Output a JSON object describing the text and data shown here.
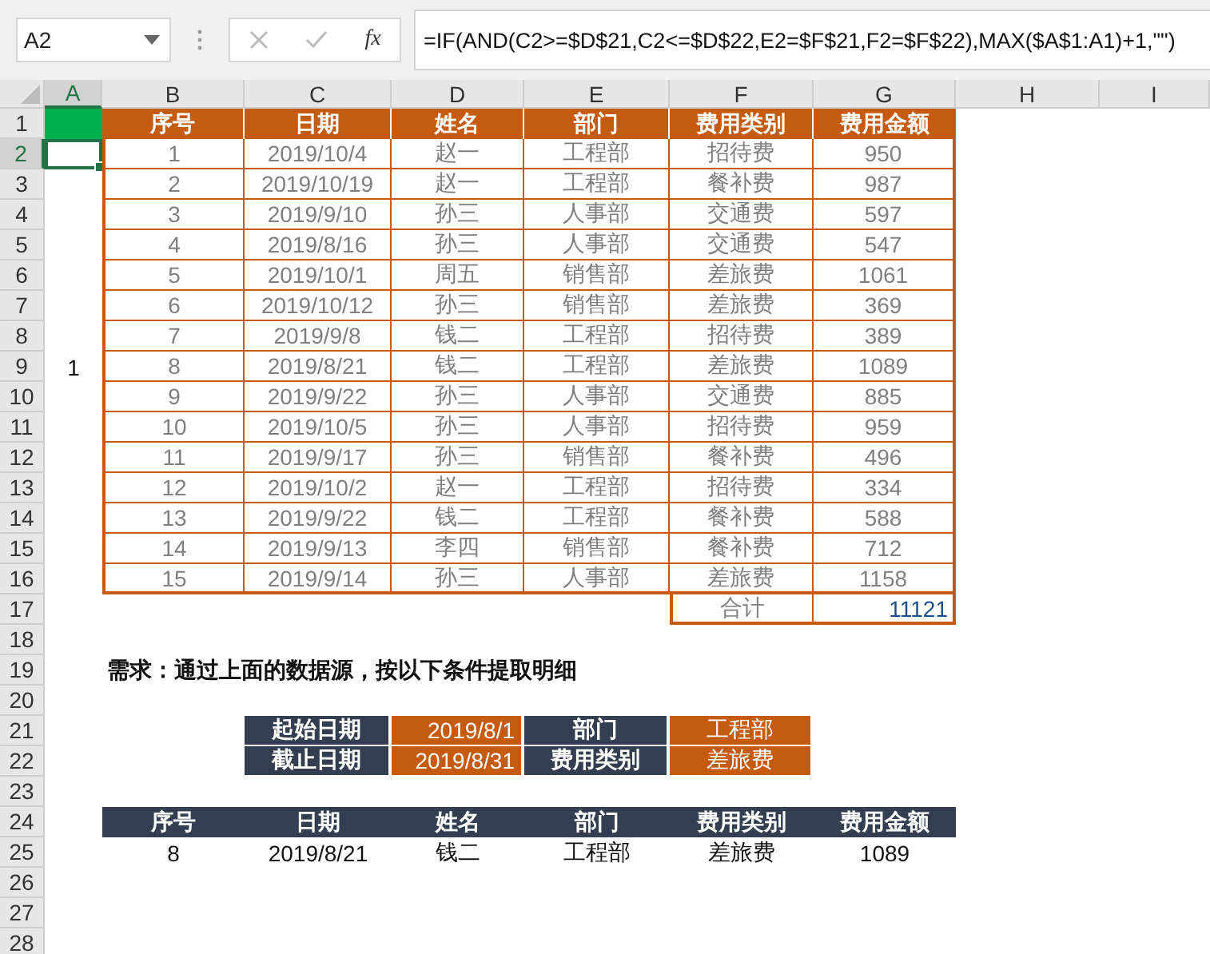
{
  "formula_bar": {
    "name_box": "A2",
    "function_label": "fx",
    "formula": "=IF(AND(C2>=$D$21,C2<=$D$22,E2=$F$21,F2=$F$22),MAX($A$1:A1)+1,\"\")"
  },
  "columns": [
    {
      "label": "A",
      "selected": true
    },
    {
      "label": "B",
      "selected": false
    },
    {
      "label": "C",
      "selected": false
    },
    {
      "label": "D",
      "selected": false
    },
    {
      "label": "E",
      "selected": false
    },
    {
      "label": "F",
      "selected": false
    },
    {
      "label": "G",
      "selected": false
    },
    {
      "label": "H",
      "selected": false
    },
    {
      "label": "I",
      "selected": false
    }
  ],
  "rows": [
    {
      "label": "1",
      "selected": false
    },
    {
      "label": "2",
      "selected": true
    },
    {
      "label": "3",
      "selected": false
    },
    {
      "label": "4",
      "selected": false
    },
    {
      "label": "5",
      "selected": false
    },
    {
      "label": "6",
      "selected": false
    },
    {
      "label": "7",
      "selected": false
    },
    {
      "label": "8",
      "selected": false
    },
    {
      "label": "9",
      "selected": false
    },
    {
      "label": "10",
      "selected": false
    },
    {
      "label": "11",
      "selected": false
    },
    {
      "label": "12",
      "selected": false
    },
    {
      "label": "13",
      "selected": false
    },
    {
      "label": "14",
      "selected": false
    },
    {
      "label": "15",
      "selected": false
    },
    {
      "label": "16",
      "selected": false
    },
    {
      "label": "17",
      "selected": false
    },
    {
      "label": "18",
      "selected": false
    },
    {
      "label": "19",
      "selected": false
    },
    {
      "label": "20",
      "selected": false
    },
    {
      "label": "21",
      "selected": false
    },
    {
      "label": "22",
      "selected": false
    },
    {
      "label": "23",
      "selected": false
    },
    {
      "label": "24",
      "selected": false
    },
    {
      "label": "25",
      "selected": false
    },
    {
      "label": "26",
      "selected": false
    },
    {
      "label": "27",
      "selected": false
    },
    {
      "label": "28",
      "selected": false
    }
  ],
  "source_table": {
    "headers": [
      "序号",
      "日期",
      "姓名",
      "部门",
      "费用类别",
      "费用金额"
    ],
    "rows": [
      {
        "helper_selected": true,
        "cells": [
          "1",
          "2019/10/4",
          "赵一",
          "工程部",
          "招待费",
          "950"
        ]
      },
      {
        "helper_selected": false,
        "cells": [
          "2",
          "2019/10/19",
          "赵一",
          "工程部",
          "餐补费",
          "987"
        ]
      },
      {
        "helper_selected": false,
        "cells": [
          "3",
          "2019/9/10",
          "孙三",
          "人事部",
          "交通费",
          "597"
        ]
      },
      {
        "helper_selected": false,
        "cells": [
          "4",
          "2019/8/16",
          "孙三",
          "人事部",
          "交通费",
          "547"
        ]
      },
      {
        "helper_selected": false,
        "cells": [
          "5",
          "2019/10/1",
          "周五",
          "销售部",
          "差旅费",
          "1061"
        ]
      },
      {
        "helper_selected": false,
        "cells": [
          "6",
          "2019/10/12",
          "孙三",
          "销售部",
          "差旅费",
          "369"
        ]
      },
      {
        "helper_selected": false,
        "cells": [
          "7",
          "2019/9/8",
          "钱二",
          "工程部",
          "招待费",
          "389"
        ]
      },
      {
        "helper_selected": false,
        "helper": "1",
        "cells": [
          "8",
          "2019/8/21",
          "钱二",
          "工程部",
          "差旅费",
          "1089"
        ]
      },
      {
        "helper_selected": false,
        "cells": [
          "9",
          "2019/9/22",
          "孙三",
          "人事部",
          "交通费",
          "885"
        ]
      },
      {
        "helper_selected": false,
        "cells": [
          "10",
          "2019/10/5",
          "孙三",
          "人事部",
          "招待费",
          "959"
        ]
      },
      {
        "helper_selected": false,
        "cells": [
          "11",
          "2019/9/17",
          "孙三",
          "销售部",
          "餐补费",
          "496"
        ]
      },
      {
        "helper_selected": false,
        "cells": [
          "12",
          "2019/10/2",
          "赵一",
          "工程部",
          "招待费",
          "334"
        ]
      },
      {
        "helper_selected": false,
        "cells": [
          "13",
          "2019/9/22",
          "钱二",
          "工程部",
          "餐补费",
          "588"
        ]
      },
      {
        "helper_selected": false,
        "cells": [
          "14",
          "2019/9/13",
          "李四",
          "销售部",
          "餐补费",
          "712"
        ]
      },
      {
        "helper_selected": false,
        "cells": [
          "15",
          "2019/9/14",
          "孙三",
          "人事部",
          "差旅费",
          "1158"
        ]
      }
    ],
    "total": {
      "label": "合计",
      "value": "11121"
    }
  },
  "requirement": "需求：通过上面的数据源，按以下条件提取明细",
  "criteria": [
    {
      "items": [
        {
          "label": "起始日期",
          "value": "2019/8/1",
          "kind": "date"
        },
        {
          "label": "部门",
          "value": "工程部",
          "kind": "text"
        }
      ]
    },
    {
      "items": [
        {
          "label": "截止日期",
          "value": "2019/8/31",
          "kind": "date"
        },
        {
          "label": "费用类别",
          "value": "差旅费",
          "kind": "text"
        }
      ]
    }
  ],
  "result_table": {
    "headers": [
      "序号",
      "日期",
      "姓名",
      "部门",
      "费用类别",
      "费用金额"
    ],
    "rows": [
      [
        "8",
        "2019/8/21",
        "钱二",
        "工程部",
        "差旅费",
        "1089"
      ]
    ]
  }
}
